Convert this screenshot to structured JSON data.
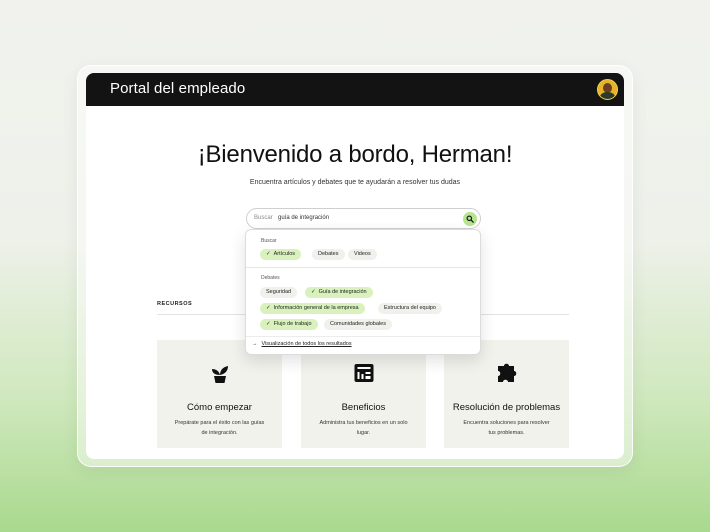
{
  "header": {
    "title": "Portal del empleado"
  },
  "welcome": {
    "title": "¡Bienvenido a bordo, Herman!",
    "subtitle": "Encuentra artículos y debates que te ayudarán a resolver tus dudas"
  },
  "search": {
    "label": "Buscar",
    "value": "guía de integración",
    "icon": "search-icon"
  },
  "dropdown": {
    "buscar_label": "Buscar",
    "buscar_chips": [
      {
        "label": "Artículos",
        "selected": true
      },
      {
        "label": "Debates",
        "selected": false
      },
      {
        "label": "Videos",
        "selected": false
      }
    ],
    "debates_label": "Debates",
    "debates_chips": [
      {
        "label": "Seguridad",
        "selected": false
      },
      {
        "label": "Guía de integración",
        "selected": true
      },
      {
        "label": "Información general de la empresa",
        "selected": true
      },
      {
        "label": "Estructura del equipo",
        "selected": false
      },
      {
        "label": "Flujo de trabajo",
        "selected": true
      },
      {
        "label": "Comunidades globales",
        "selected": false
      }
    ],
    "footer_link": "Visualización de todos los resultados"
  },
  "resources": {
    "section_label": "RECURSOS",
    "cards": [
      {
        "title": "Cómo empezar",
        "desc": "Prepárate para el éxito con las guías de integración.",
        "icon": "plant-icon"
      },
      {
        "title": "Beneficios",
        "desc": "Administra tus beneficios en un solo lugar.",
        "icon": "benefits-icon"
      },
      {
        "title": "Resolución de problemas",
        "desc": "Encuentra soluciones para resolver tus problemas.",
        "icon": "puzzle-icon"
      }
    ]
  },
  "colors": {
    "accent": "#b6e48f",
    "chip_selected": "#d9f2bd",
    "topbar": "#131313"
  }
}
